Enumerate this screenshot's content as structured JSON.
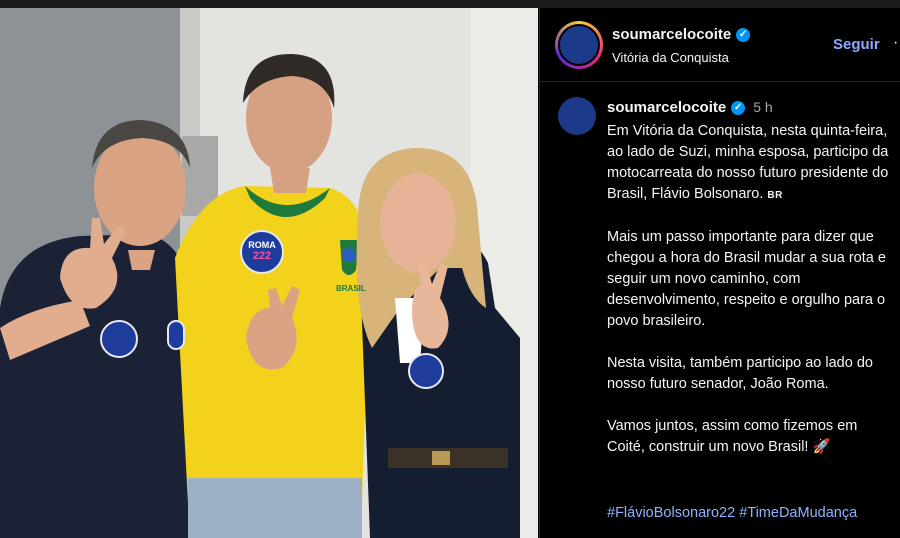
{
  "post": {
    "username": "soumarcelocoite",
    "location": "Vitória da Conquista",
    "follow_label": "Seguir",
    "more_label": "·",
    "time": "5 h",
    "verified_mark": "✓",
    "caption": {
      "p1": "Em Vitória da Conquista, nesta quinta-feira, ao lado de Suzi, minha esposa, participo da motocarreata do nosso futuro presidente do Brasil, Flávio Bolsonaro.",
      "flag": "BR",
      "p2": "Mais um passo importante para dizer que chegou a hora do Brasil mudar a sua rota e seguir um novo caminho, com desenvolvimento, respeito e orgulho para o povo brasileiro.",
      "p3": "Nesta visita, também participo ao lado do nosso futuro senador, João Roma.",
      "p4": "Vamos juntos, assim como fizemos em Coité, construir um novo Brasil! 🚀"
    },
    "hashtags": [
      "#FlávioBolsonaro22",
      "#TimeDaMudança"
    ]
  },
  "photo": {
    "sticker_text": "ROMA",
    "sticker_number": "222",
    "jersey_text": "BRASIL"
  },
  "colors": {
    "jersey_yellow": "#f2d21b",
    "jersey_green": "#1e7a3c",
    "navy": "#1b2236",
    "link_blue": "#8fb3ff"
  }
}
